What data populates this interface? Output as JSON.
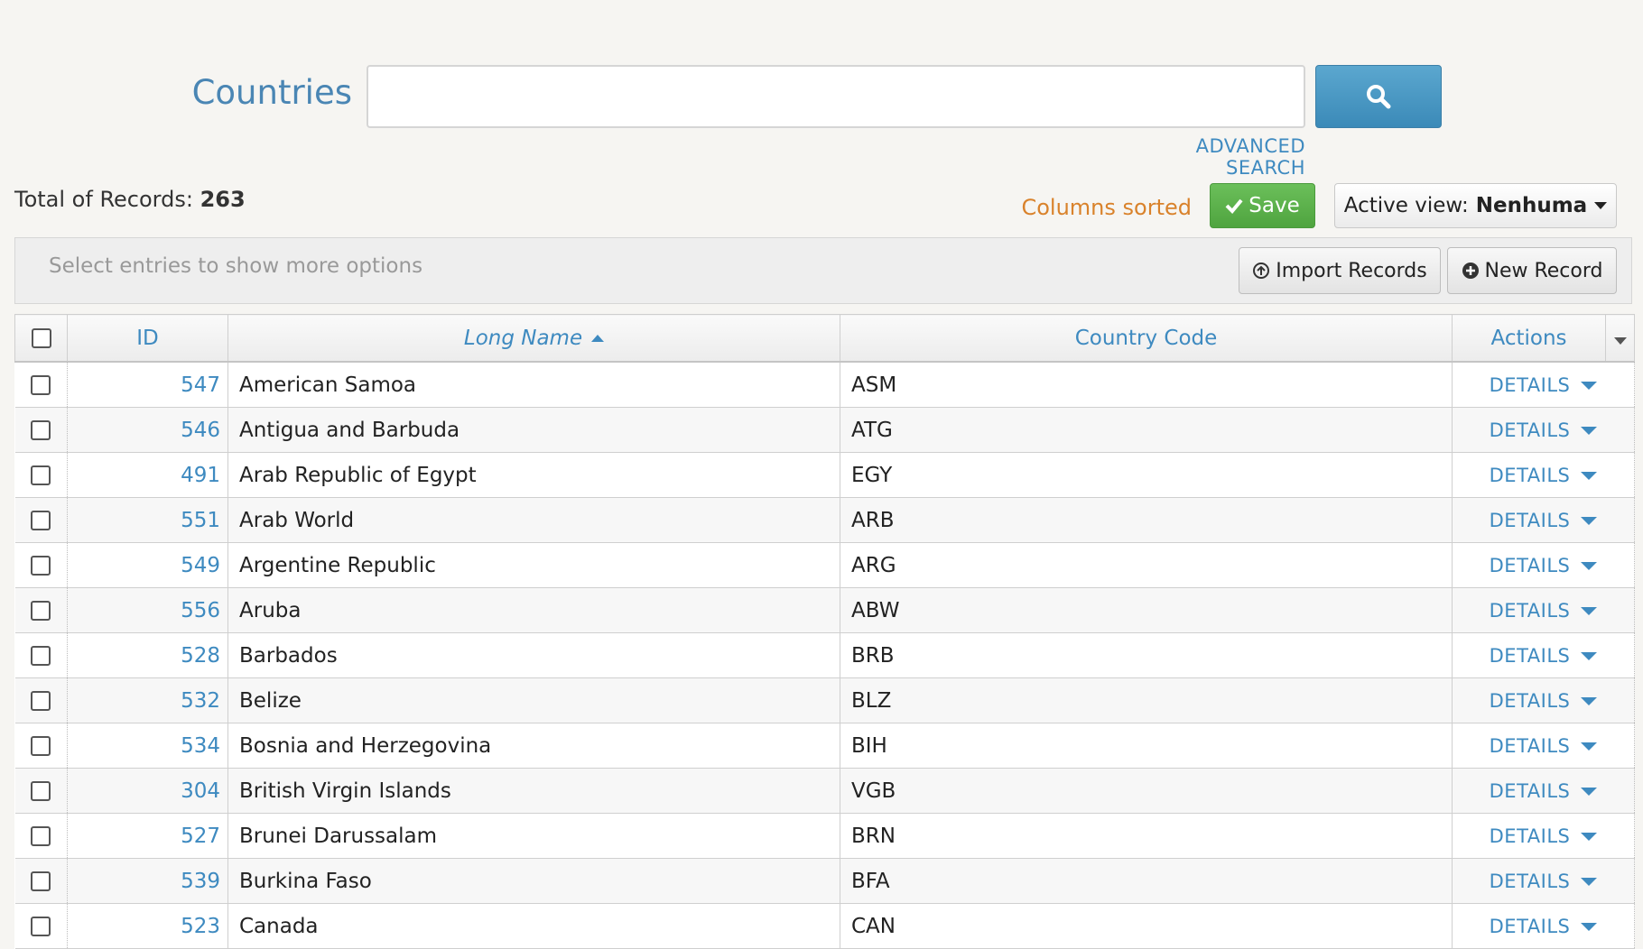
{
  "search": {
    "title": "Countries",
    "placeholder": "",
    "advanced_label": "ADVANCED SEARCH"
  },
  "summary": {
    "total_label": "Total of Records:",
    "total_value": "263",
    "columns_sorted": "Columns sorted",
    "save_label": "Save",
    "active_view_label": "Active view:",
    "active_view_value": "Nenhuma"
  },
  "toolbar": {
    "hint": "Select entries to show more options",
    "import_label": "Import Records",
    "new_label": "New Record"
  },
  "table": {
    "columns": [
      "ID",
      "Long Name",
      "Country Code",
      "Actions"
    ],
    "sorted_column": "Long Name",
    "action_label": "DETAILS",
    "rows": [
      {
        "id": "547",
        "name": "American Samoa",
        "code": "ASM"
      },
      {
        "id": "546",
        "name": "Antigua and Barbuda",
        "code": "ATG"
      },
      {
        "id": "491",
        "name": "Arab Republic of Egypt",
        "code": "EGY"
      },
      {
        "id": "551",
        "name": "Arab World",
        "code": "ARB"
      },
      {
        "id": "549",
        "name": "Argentine Republic",
        "code": "ARG"
      },
      {
        "id": "556",
        "name": "Aruba",
        "code": "ABW"
      },
      {
        "id": "528",
        "name": "Barbados",
        "code": "BRB"
      },
      {
        "id": "532",
        "name": "Belize",
        "code": "BLZ"
      },
      {
        "id": "534",
        "name": "Bosnia and Herzegovina",
        "code": "BIH"
      },
      {
        "id": "304",
        "name": "British Virgin Islands",
        "code": "VGB"
      },
      {
        "id": "527",
        "name": "Brunei Darussalam",
        "code": "BRN"
      },
      {
        "id": "539",
        "name": "Burkina Faso",
        "code": "BFA"
      },
      {
        "id": "523",
        "name": "Canada",
        "code": "CAN"
      }
    ]
  },
  "colors": {
    "accent": "#3e8ac0",
    "save_green": "#5aae48",
    "sorted_orange": "#d9822b"
  }
}
